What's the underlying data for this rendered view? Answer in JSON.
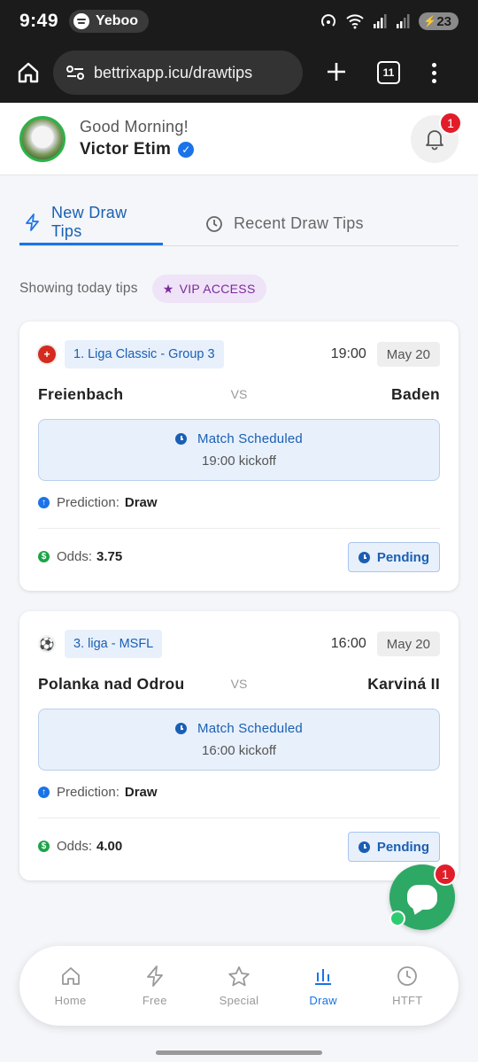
{
  "status_bar": {
    "time": "9:49",
    "media_label": "Yeboo",
    "battery": "23"
  },
  "browser": {
    "url": "bettrixapp.icu/drawtips",
    "tab_count": "11"
  },
  "header": {
    "greeting": "Good Morning!",
    "user_name": "Victor Etim",
    "notification_count": "1"
  },
  "tabs": [
    {
      "label": "New Draw Tips",
      "active": true
    },
    {
      "label": "Recent Draw Tips",
      "active": false
    }
  ],
  "subheader": {
    "text": "Showing today tips",
    "vip_label": "VIP ACCESS"
  },
  "matches": [
    {
      "league": "1. Liga Classic - Group 3",
      "time": "19:00",
      "date": "May 20",
      "home": "Freienbach",
      "vs": "VS",
      "away": "Baden",
      "status": "Match Scheduled",
      "kickoff": "19:00 kickoff",
      "prediction_label": "Prediction:",
      "prediction": "Draw",
      "odds_label": "Odds:",
      "odds": "3.75",
      "result": "Pending"
    },
    {
      "league": "3. liga - MSFL",
      "time": "16:00",
      "date": "May 20",
      "home": "Polanka nad Odrou",
      "vs": "VS",
      "away": "Karviná II",
      "status": "Match Scheduled",
      "kickoff": "16:00 kickoff",
      "prediction_label": "Prediction:",
      "prediction": "Draw",
      "odds_label": "Odds:",
      "odds": "4.00",
      "result": "Pending"
    }
  ],
  "chat": {
    "badge": "1"
  },
  "bottom_nav": [
    {
      "label": "Home",
      "icon": "home-icon"
    },
    {
      "label": "Free",
      "icon": "bolt-icon"
    },
    {
      "label": "Special",
      "icon": "star-icon"
    },
    {
      "label": "Draw",
      "icon": "bar-chart-icon",
      "active": true
    },
    {
      "label": "HTFT",
      "icon": "clock-icon"
    }
  ],
  "colors": {
    "accent": "#1a73e8",
    "vip": "#7a2a9b",
    "chat": "#2ea865",
    "badge": "#e11d2a"
  }
}
